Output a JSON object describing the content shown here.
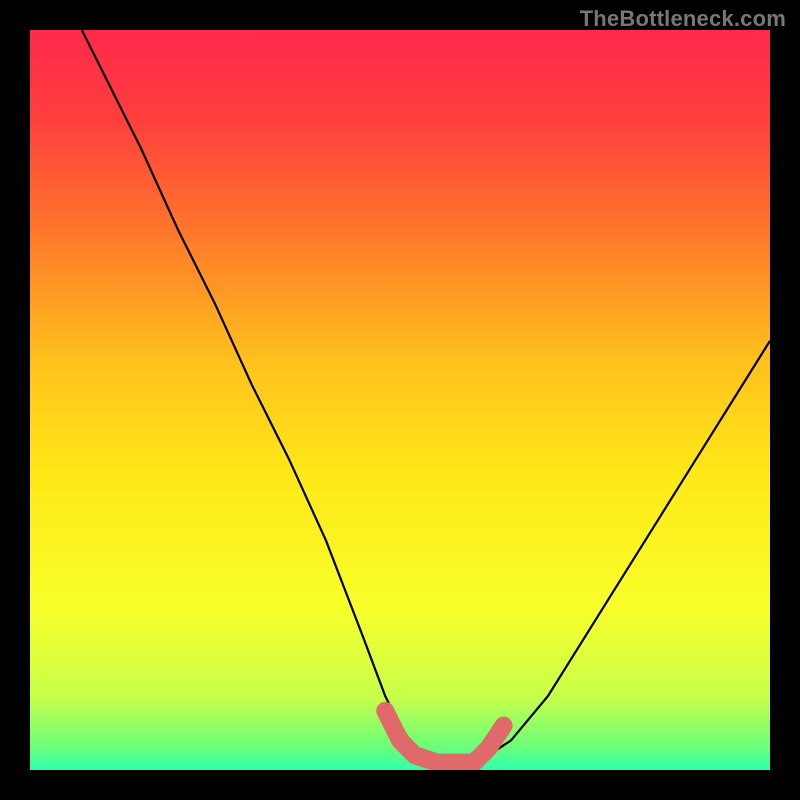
{
  "watermark": "TheBottleneck.com",
  "colors": {
    "frame": "#000000",
    "gradient_stops": [
      {
        "offset": 0.0,
        "color": "#ff2a4a"
      },
      {
        "offset": 0.12,
        "color": "#ff3e3e"
      },
      {
        "offset": 0.28,
        "color": "#ff7a2a"
      },
      {
        "offset": 0.45,
        "color": "#ffc21c"
      },
      {
        "offset": 0.6,
        "color": "#ffe818"
      },
      {
        "offset": 0.78,
        "color": "#f8ff2a"
      },
      {
        "offset": 0.9,
        "color": "#c8ff4a"
      },
      {
        "offset": 0.97,
        "color": "#6aff7a"
      },
      {
        "offset": 1.0,
        "color": "#2dffb0"
      }
    ],
    "curve": "#000000",
    "marker": "#e06a6a"
  },
  "chart_data": {
    "type": "line",
    "title": "",
    "xlabel": "",
    "ylabel": "",
    "xlim": [
      0,
      100
    ],
    "ylim": [
      0,
      100
    ],
    "grid": false,
    "series": [
      {
        "name": "bottleneck-curve",
        "x": [
          7,
          10,
          15,
          20,
          25,
          30,
          35,
          40,
          45,
          48,
          50,
          52,
          55,
          58,
          60,
          62,
          65,
          70,
          75,
          80,
          85,
          90,
          95,
          100
        ],
        "y": [
          100,
          94,
          84,
          73,
          63,
          52,
          42,
          31,
          18,
          10,
          6,
          3,
          1,
          1,
          1,
          2,
          4,
          10,
          18,
          26,
          34,
          42,
          50,
          58
        ]
      }
    ],
    "annotations": [
      {
        "name": "optimal-trough-marker",
        "type": "path",
        "points_x": [
          48,
          50,
          52,
          55,
          58,
          60,
          62,
          64
        ],
        "points_y": [
          8,
          4,
          2,
          1,
          1,
          1,
          3,
          6
        ]
      }
    ]
  }
}
